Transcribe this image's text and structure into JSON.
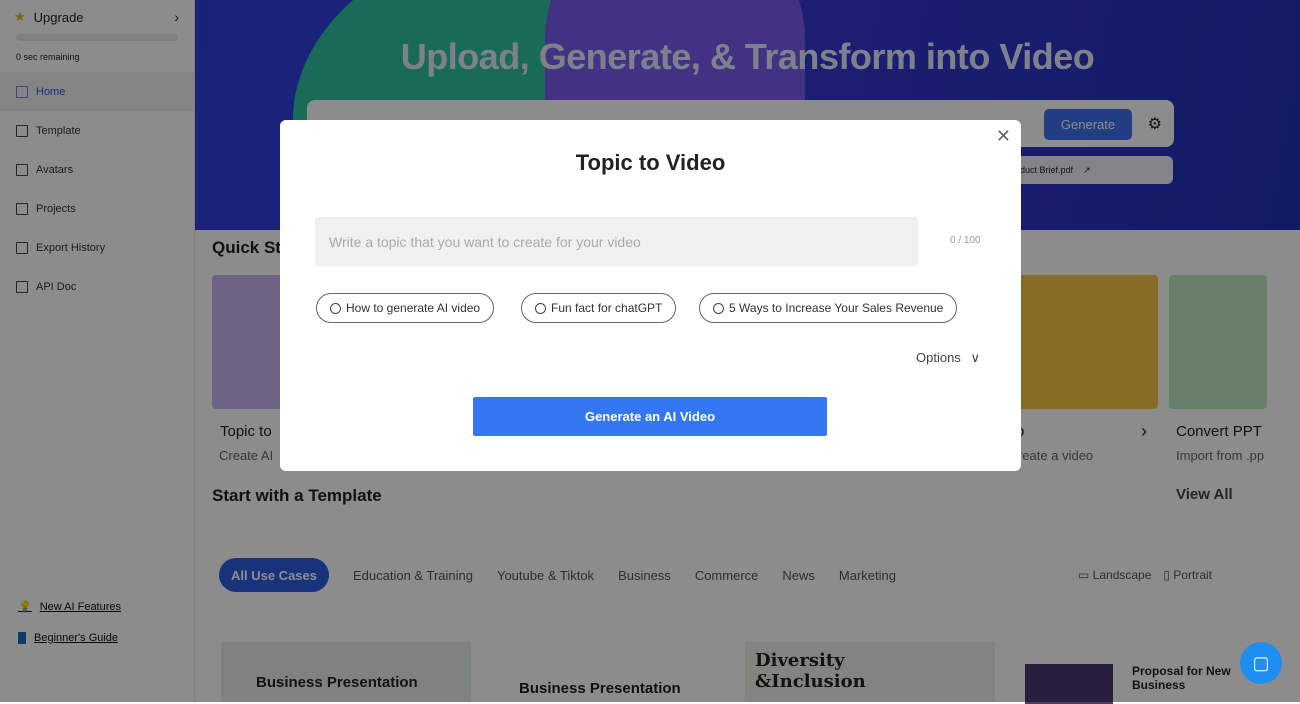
{
  "sidebar": {
    "upgrade": "Upgrade",
    "remaining": "0 sec remaining",
    "items": [
      {
        "label": "Home",
        "icon": "home-icon"
      },
      {
        "label": "Template",
        "icon": "template-icon"
      },
      {
        "label": "Avatars",
        "icon": "avatar-icon"
      },
      {
        "label": "Projects",
        "icon": "projects-icon"
      },
      {
        "label": "Export History",
        "icon": "list-icon"
      },
      {
        "label": "API Doc",
        "icon": "document-icon"
      }
    ],
    "new_features": "New AI Features",
    "guide": "Beginner's Guide"
  },
  "hero": {
    "title": "Upload, Generate, & Transform into Video",
    "generate": "Generate",
    "file": "duct Brief.pdf"
  },
  "quick_start": {
    "title": "Quick St",
    "cards": [
      {
        "title": "Topic to",
        "sub": "Create AI"
      },
      {
        "title": "o",
        "sub": "reate a video"
      },
      {
        "title": "Convert PPT",
        "sub": "Import from .pp"
      }
    ]
  },
  "templates": {
    "title": "Start with a Template",
    "view_all": "View All",
    "tabs": [
      "All Use Cases",
      "Education & Training",
      "Youtube & Tiktok",
      "Business",
      "Commerce",
      "News",
      "Marketing"
    ],
    "landscape": "Landscape",
    "portrait": "Portrait",
    "cards": [
      "Business Presentation",
      "Business Presentation",
      "Diversity &Inclusion",
      "Proposal for New Business"
    ]
  },
  "modal": {
    "title": "Topic to Video",
    "placeholder": "Write a topic that you want to create for your video",
    "count": "0 / 100",
    "chips": [
      "How to generate AI video",
      "Fun fact for chatGPT",
      "5 Ways to Increase Your Sales Revenue"
    ],
    "options": "Options",
    "button": "Generate an AI Video"
  },
  "colors": {
    "accent": "#3477f2",
    "active_tab": "#2a5ee0"
  }
}
